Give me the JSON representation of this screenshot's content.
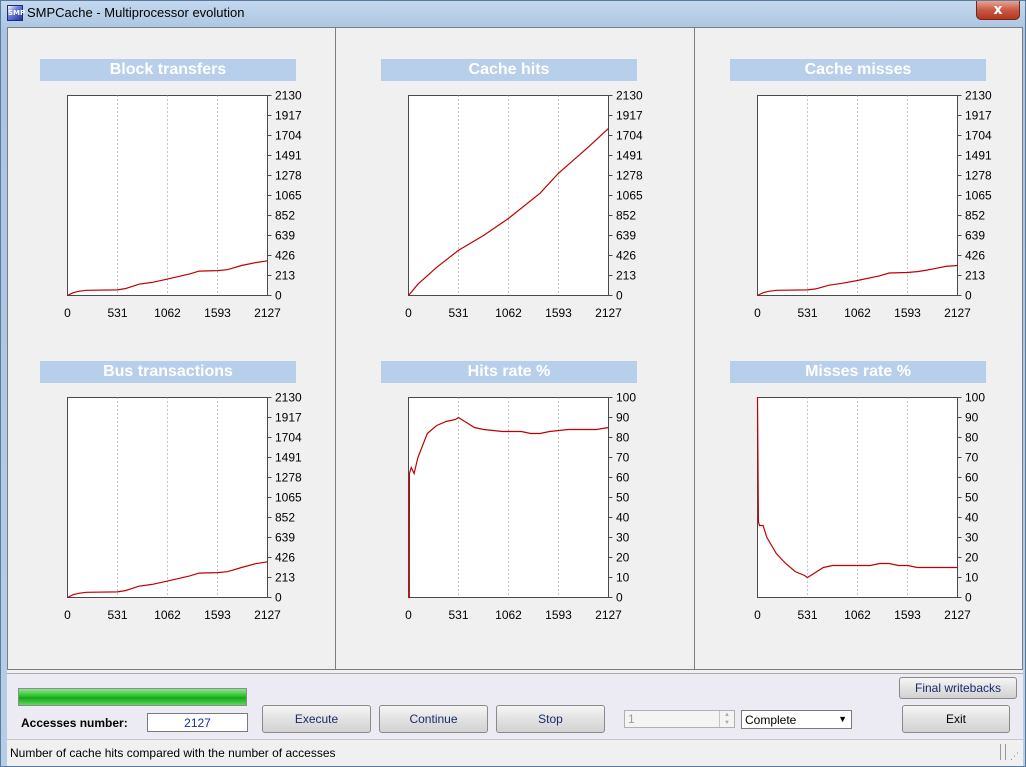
{
  "window": {
    "title": "SMPCache - Multiprocessor evolution",
    "icon": "app-icon",
    "close_label": "x",
    "icon_text": "SMP"
  },
  "chart_data": [
    {
      "type": "line",
      "title": "Block transfers",
      "xticks": [
        "0",
        "531",
        "1062",
        "1593",
        "2127"
      ],
      "yticks": [
        "0",
        "213",
        "426",
        "639",
        "852",
        "1065",
        "1278",
        "1491",
        "1704",
        "1917",
        "2130"
      ],
      "xlim": [
        0,
        2127
      ],
      "ylim": [
        0,
        2130
      ],
      "grid": true,
      "color": "#c00000",
      "series": [
        {
          "x": [
            0,
            60,
            120,
            200,
            531,
            620,
            760,
            900,
            1062,
            1300,
            1400,
            1593,
            1700,
            1750,
            1850,
            2000,
            2127
          ],
          "y": [
            0,
            30,
            45,
            55,
            60,
            75,
            120,
            140,
            175,
            230,
            260,
            265,
            275,
            290,
            320,
            350,
            370
          ]
        }
      ]
    },
    {
      "type": "line",
      "title": "Cache hits",
      "xticks": [
        "0",
        "531",
        "1062",
        "1593",
        "2127"
      ],
      "yticks": [
        "0",
        "213",
        "426",
        "639",
        "852",
        "1065",
        "1278",
        "1491",
        "1704",
        "1917",
        "2130"
      ],
      "xlim": [
        0,
        2127
      ],
      "ylim": [
        0,
        2130
      ],
      "grid": true,
      "color": "#c00000",
      "series": [
        {
          "x": [
            0,
            100,
            300,
            531,
            800,
            1062,
            1400,
            1593,
            1900,
            2127
          ],
          "y": [
            0,
            120,
            300,
            480,
            640,
            820,
            1090,
            1300,
            1570,
            1780
          ]
        }
      ]
    },
    {
      "type": "line",
      "title": "Cache misses",
      "xticks": [
        "0",
        "531",
        "1062",
        "1593",
        "2127"
      ],
      "yticks": [
        "0",
        "213",
        "426",
        "639",
        "852",
        "1065",
        "1278",
        "1491",
        "1704",
        "1917",
        "2130"
      ],
      "xlim": [
        0,
        2127
      ],
      "ylim": [
        0,
        2130
      ],
      "grid": true,
      "color": "#c00000",
      "series": [
        {
          "x": [
            0,
            60,
            120,
            200,
            531,
            620,
            760,
            900,
            1062,
            1300,
            1400,
            1593,
            1700,
            1800,
            1900,
            2000,
            2127
          ],
          "y": [
            0,
            30,
            45,
            55,
            60,
            70,
            110,
            130,
            160,
            210,
            240,
            245,
            255,
            270,
            290,
            310,
            320
          ]
        }
      ]
    },
    {
      "type": "line",
      "title": "Bus transactions",
      "xticks": [
        "0",
        "531",
        "1062",
        "1593",
        "2127"
      ],
      "yticks": [
        "0",
        "213",
        "426",
        "639",
        "852",
        "1065",
        "1278",
        "1491",
        "1704",
        "1917",
        "2130"
      ],
      "xlim": [
        0,
        2127
      ],
      "ylim": [
        0,
        2130
      ],
      "grid": true,
      "color": "#c00000",
      "series": [
        {
          "x": [
            0,
            60,
            120,
            200,
            531,
            620,
            760,
            900,
            1062,
            1300,
            1400,
            1593,
            1700,
            1750,
            1850,
            2000,
            2127
          ],
          "y": [
            0,
            30,
            45,
            55,
            60,
            75,
            120,
            140,
            175,
            230,
            260,
            265,
            275,
            290,
            320,
            360,
            380
          ]
        }
      ]
    },
    {
      "type": "line",
      "title": "Hits rate %",
      "xticks": [
        "0",
        "531",
        "1062",
        "1593",
        "2127"
      ],
      "yticks": [
        "0",
        "10",
        "20",
        "30",
        "40",
        "50",
        "60",
        "70",
        "80",
        "90",
        "100"
      ],
      "xlim": [
        0,
        2127
      ],
      "ylim": [
        0,
        100
      ],
      "grid": true,
      "color": "#c00000",
      "series": [
        {
          "x": [
            0,
            8,
            10,
            30,
            60,
            80,
            100,
            150,
            200,
            300,
            400,
            500,
            531,
            600,
            700,
            800,
            1000,
            1200,
            1300,
            1400,
            1500,
            1700,
            1800,
            2000,
            2127
          ],
          "y": [
            0,
            0,
            62,
            65,
            62,
            66,
            70,
            76,
            82,
            86,
            88,
            89,
            90,
            88,
            85,
            84,
            83,
            83,
            82,
            82,
            83,
            84,
            84,
            84,
            85
          ]
        }
      ]
    },
    {
      "type": "line",
      "title": "Misses rate %",
      "xticks": [
        "0",
        "531",
        "1062",
        "1593",
        "2127"
      ],
      "yticks": [
        "0",
        "10",
        "20",
        "30",
        "40",
        "50",
        "60",
        "70",
        "80",
        "90",
        "100"
      ],
      "xlim": [
        0,
        2127
      ],
      "ylim": [
        0,
        100
      ],
      "grid": true,
      "color": "#c00000",
      "series": [
        {
          "x": [
            0,
            10,
            20,
            60,
            100,
            200,
            300,
            400,
            500,
            531,
            600,
            700,
            800,
            1000,
            1200,
            1300,
            1400,
            1500,
            1600,
            1700,
            1800,
            2000,
            2127
          ],
          "y": [
            100,
            38,
            36,
            36,
            30,
            22,
            17,
            13,
            11,
            10,
            12,
            15,
            16,
            16,
            16,
            17,
            17,
            16,
            16,
            15,
            15,
            15,
            15
          ]
        }
      ]
    }
  ],
  "controls": {
    "progress_fraction": 1.0,
    "accesses_label": "Accesses number:",
    "accesses_value": "2127",
    "execute_label": "Execute",
    "continue_label": "Continue",
    "stop_label": "Stop",
    "step_value": "1",
    "mode_value": "Complete",
    "final_writebacks_label": "Final writebacks",
    "exit_label": "Exit"
  },
  "status": {
    "text": "Number of cache hits compared with the number of accesses"
  }
}
